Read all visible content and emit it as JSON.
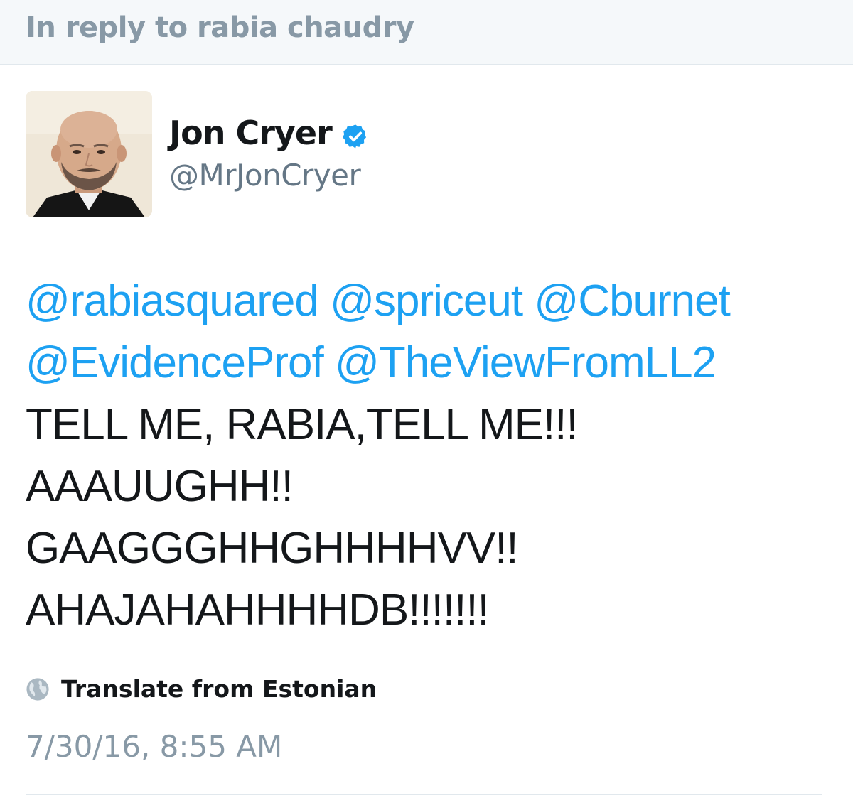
{
  "reply_banner": {
    "text": "In reply to rabia chaudry"
  },
  "author": {
    "name": "Jon Cryer",
    "handle": "@MrJonCryer",
    "verified_icon": "verified-badge-icon",
    "avatar": "profile-photo"
  },
  "tweet": {
    "mentions_line1": [
      "@rabiasquared",
      "@spriceut",
      "@Cburnet"
    ],
    "mentions_line2": [
      "@EvidenceProf",
      "@TheViewFromLL2"
    ],
    "body_lines": [
      "TELL ME, RABIA,TELL ME!!!",
      "AAAUUGHH!!",
      "GAAGGGHHGHHHHVV!!",
      "AHAJAHAHHHHDB!!!!!!!"
    ]
  },
  "translate": {
    "label": "Translate from Estonian",
    "icon": "globe-icon"
  },
  "timestamp": "7/30/16, 8:55 AM",
  "colors": {
    "mention": "#1da1f2",
    "text": "#14171a",
    "muted": "#8899a6",
    "banner_bg": "#f5f8fa"
  }
}
